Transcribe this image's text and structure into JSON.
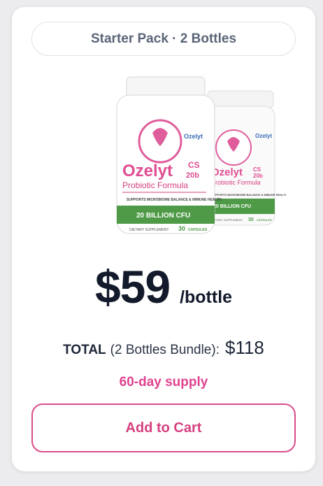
{
  "pack": {
    "label": "Starter Pack · 2 Bottles"
  },
  "product": {
    "brand": "Ozelyt",
    "variant": "CS",
    "variant_sub": "20b",
    "subtitle": "Probiotic Formula",
    "claim": "SUPPORTS MICROBIOME BALANCE & IMMUNE HEALTH",
    "strength": "20 BILLION CFU",
    "footer": "DIETARY SUPPLEMENT",
    "count": "30",
    "count_unit": "CAPSULES"
  },
  "pricing": {
    "price": "$59",
    "per": "/bottle",
    "total_label": "TOTAL",
    "total_bundle": "(2 Bottles Bundle):",
    "total_value": "$118",
    "supply": "60-day supply"
  },
  "cart": {
    "label": "Add to Cart"
  },
  "colors": {
    "accent": "#d94d8a",
    "bottle_green": "#4e9a47",
    "price_text": "#121a2b"
  }
}
